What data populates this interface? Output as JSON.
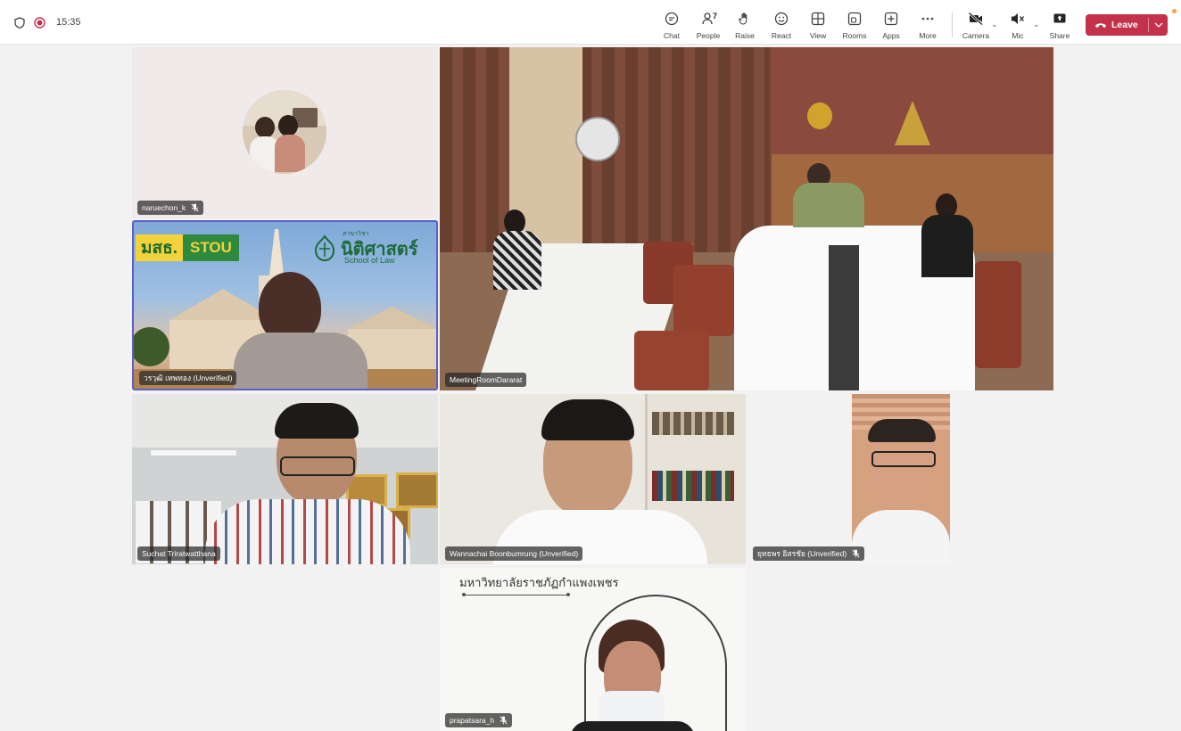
{
  "status": {
    "time": "15:35"
  },
  "toolbar": {
    "chat": "Chat",
    "people": "People",
    "people_count": "7",
    "raise": "Raise",
    "react": "React",
    "view": "View",
    "rooms": "Rooms",
    "apps": "Apps",
    "more": "More",
    "camera": "Camera",
    "mic": "Mic",
    "share": "Share",
    "leave": "Leave"
  },
  "participants": [
    {
      "name": "naruechon_k",
      "muted": true
    },
    {
      "name": "วรวุฒิ เทพทอง (Unverified)",
      "muted": false
    },
    {
      "name": "MeetingRoomDararat",
      "muted": false
    },
    {
      "name": "Suchat Triratwatthana",
      "muted": false
    },
    {
      "name": "Wannachai Boonbumrung (Unverified)",
      "muted": false
    },
    {
      "name": "ยุทธพร อิสรชัย (Unverified)",
      "muted": true
    },
    {
      "name": "prapatsara_h",
      "muted": true
    }
  ],
  "backgrounds": {
    "stou_logo_left": "มสธ.",
    "stou_logo_right": "STOU",
    "stou_faculty_th": "นิติศาสตร์",
    "stou_faculty_en": "School of Law",
    "stou_faculty_small": "สาขาวิชา",
    "university_banner": "มหาวิทยาลัยราชภัฏกำแพงเพชร"
  },
  "colors": {
    "leave": "#c4314b",
    "active_speaker_border": "#5b5fc7",
    "stou_green": "#2d8a3e",
    "stou_yellow": "#f4d23c"
  }
}
